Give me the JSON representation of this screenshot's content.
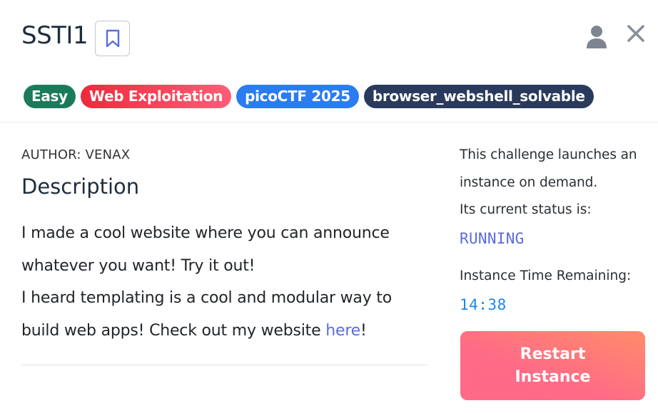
{
  "challenge": {
    "title": "SSTI1",
    "tags": [
      {
        "label": "Easy",
        "color": "#1b7a5a"
      },
      {
        "label": "Web Exploitation",
        "color": "#f0364a"
      },
      {
        "label": "picoCTF 2025",
        "color": "#2a7cf0"
      },
      {
        "label": "browser_webshell_solvable",
        "color": "#2a3a5c"
      }
    ],
    "author": "AUTHOR: VENAX",
    "description_heading": "Description",
    "description": {
      "line1": "I made a cool website where you can announce whatever you want! Try it out!",
      "line2_before_link": "I heard templating is a cool and modular way to build web apps! Check out my website ",
      "link_text": "here",
      "line2_after_link": "!"
    }
  },
  "instance": {
    "intro": "This challenge launches an instance on demand.",
    "status_label": "Its current status is:",
    "status_value": "RUNNING",
    "time_label": "Instance Time Remaining:",
    "time_value": "14:38",
    "restart_label": "Restart Instance"
  },
  "icons": {
    "bookmark": "bookmark-icon",
    "user": "user-icon",
    "close": "close-icon"
  },
  "colors": {
    "accent": "#5a6ce0",
    "timer": "#1e88e5",
    "restart_button": "#ff6b86"
  }
}
